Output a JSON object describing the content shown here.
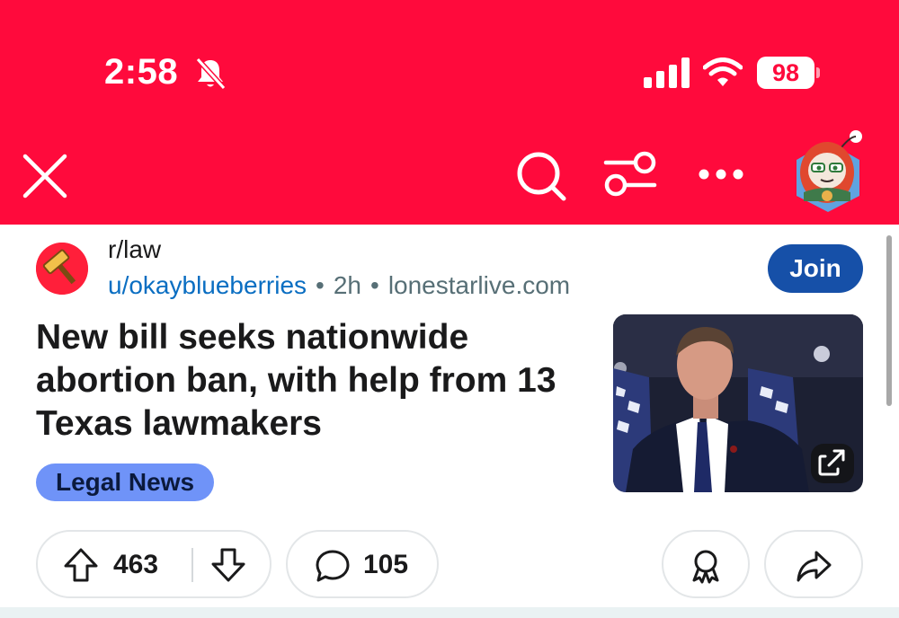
{
  "status_bar": {
    "time": "2:58",
    "battery": "98",
    "icons": [
      "bell-slash-icon",
      "signal-icon",
      "wifi-icon",
      "battery-icon"
    ]
  },
  "toolbar": {
    "icons": [
      "close-icon",
      "search-icon",
      "filter-icon",
      "more-icon",
      "avatar"
    ],
    "accent_color": "#ff0a3c"
  },
  "post": {
    "subreddit": "r/law",
    "author": "u/okayblueberries",
    "age": "2h",
    "domain": "lonestarlive.com",
    "join_label": "Join",
    "title": "New bill seeks nationwide abortion ban, with help from 13 Texas lawmakers",
    "flair": "Legal News",
    "score": "463",
    "comments": "105",
    "colors": {
      "join": "#1650a8",
      "flair": "#6f93f8",
      "author_link": "#0a6ec2"
    }
  }
}
